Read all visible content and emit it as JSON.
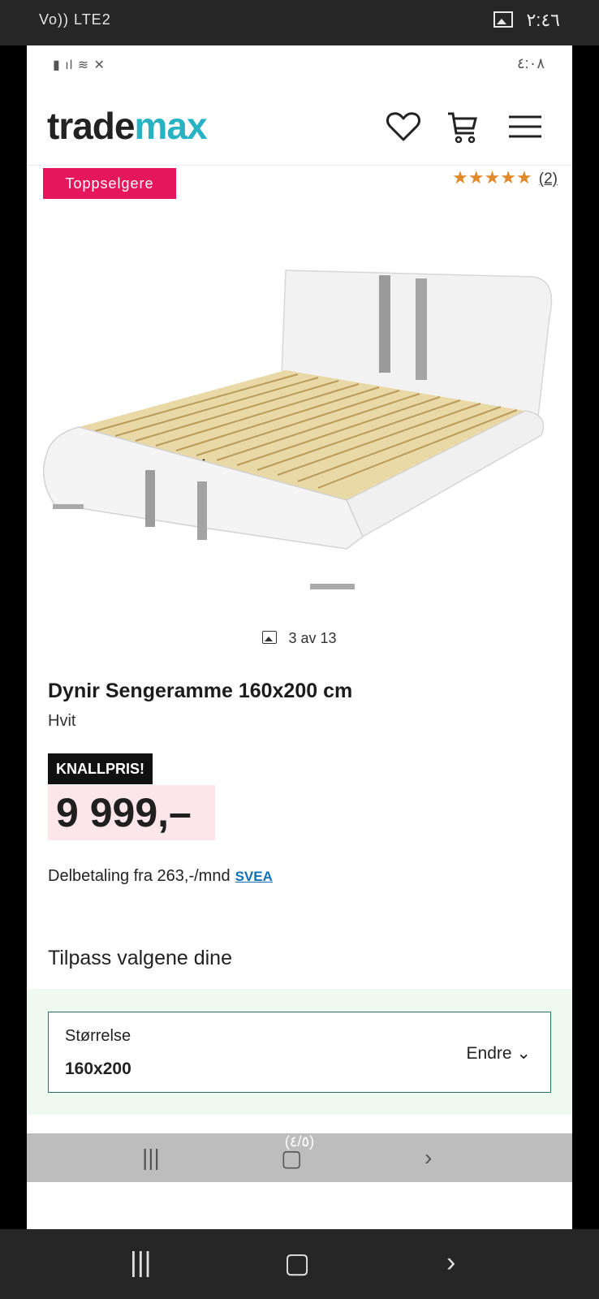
{
  "system_status": {
    "left": "Vo)) LTE2",
    "time": "٢:٤٦"
  },
  "inner_status": {
    "time": "٤:٠٨"
  },
  "header": {
    "logo_part1": "trade",
    "logo_part2": "max"
  },
  "badge": "Toppselgere",
  "rating": {
    "stars": "★★★★★",
    "count": "(2)"
  },
  "gallery": {
    "counter": "3 av 13"
  },
  "product": {
    "title": "Dynir Sengeramme 160x200 cm",
    "variant": "Hvit",
    "tag": "KNALLPRIS!",
    "price": "9 999,–",
    "finance_text": "Delbetaling fra 263,-/mnd",
    "finance_brand": "SVEA"
  },
  "options": {
    "section_title": "Tilpass valgene dine",
    "label": "Størrelse",
    "value": "160x200",
    "change_label": "Endre ⌄"
  },
  "inner_nav": {
    "page": "(٤/٥)"
  },
  "colors": {
    "brand_teal": "#27b3c4",
    "badge_pink": "#e6165d",
    "price_bg": "#fce6ec",
    "star": "#e08a2c"
  }
}
